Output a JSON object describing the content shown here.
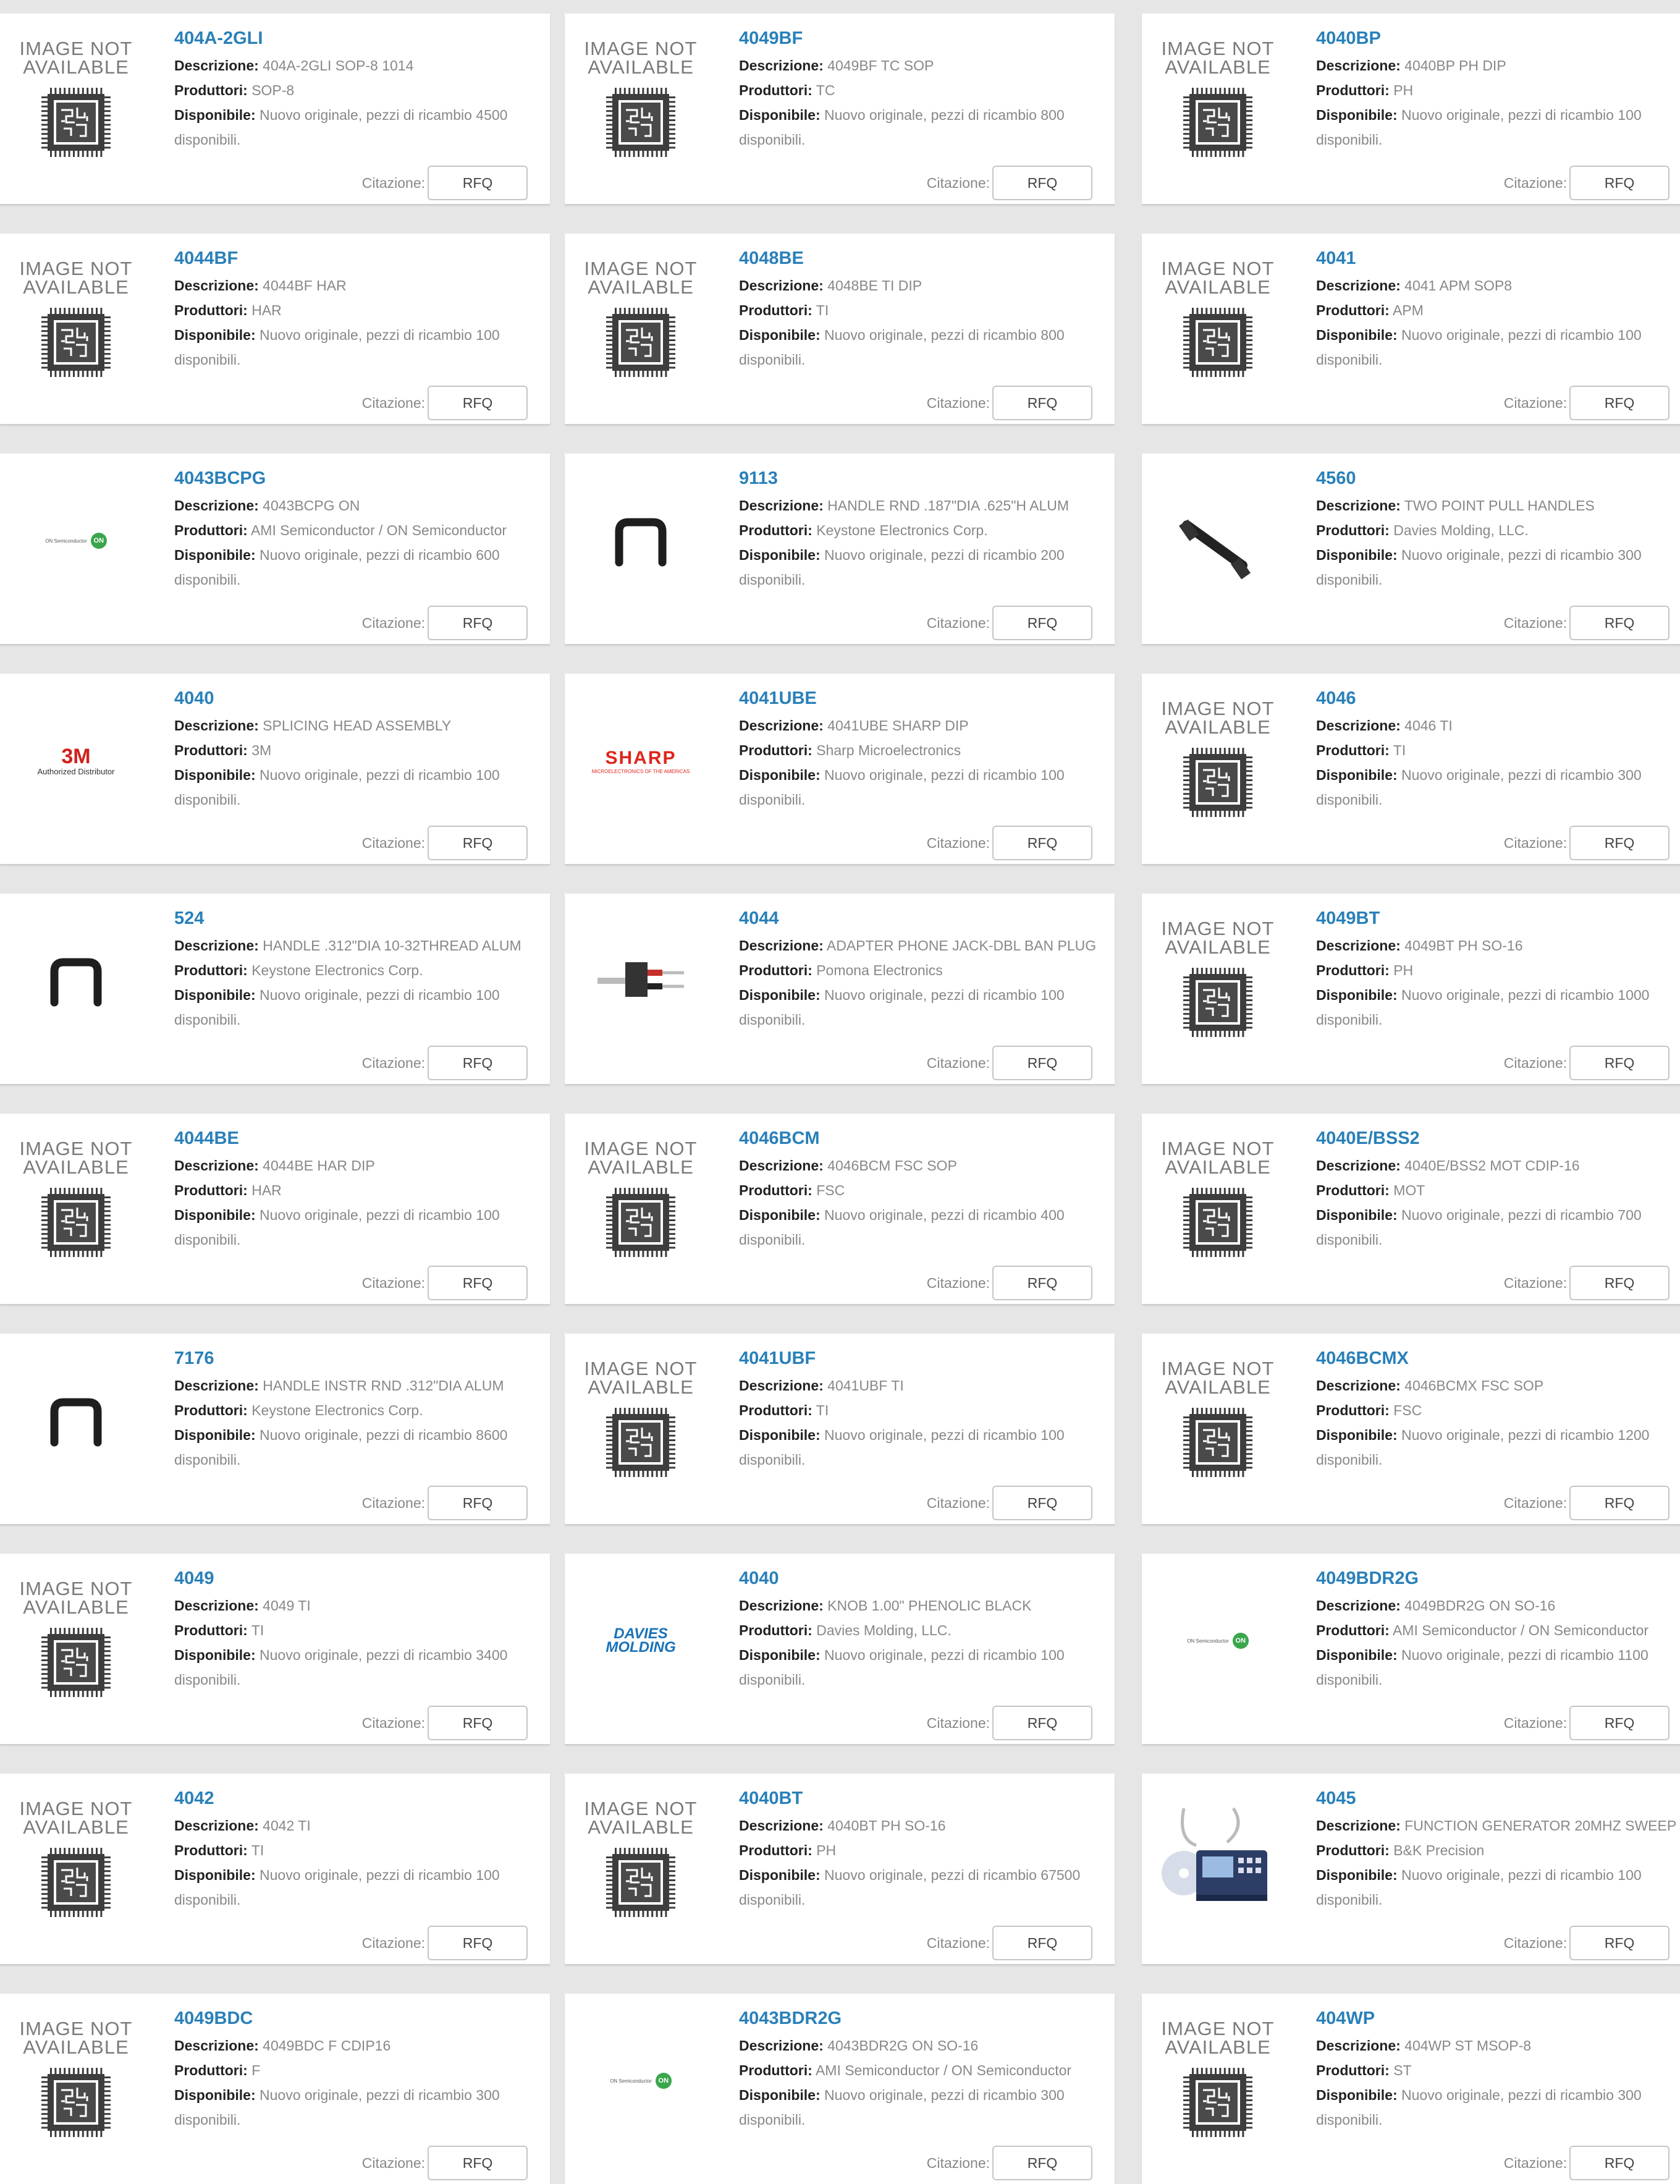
{
  "labels": {
    "description": "Descrizione:",
    "manufacturer": "Produttori:",
    "available": "Disponibile:",
    "quote": "Citazione:",
    "rfq": "RFQ",
    "image_not_available_1": "IMAGE NOT",
    "image_not_available_2": "AVAILABLE"
  },
  "products": [
    {
      "pn": "404A-2GLI",
      "desc": "404A-2GLI SOP-8 1014",
      "mfr": "SOP-8",
      "avail": "Nuovo originale, pezzi di ricambio 4500 disponibili.",
      "image": "image-not-available"
    },
    {
      "pn": "4049BF",
      "desc": "4049BF TC SOP",
      "mfr": "TC",
      "avail": "Nuovo originale, pezzi di ricambio 800 disponibili.",
      "image": "image-not-available"
    },
    {
      "pn": "4040BP",
      "desc": "4040BP PH DIP",
      "mfr": "PH",
      "avail": "Nuovo originale, pezzi di ricambio 100 disponibili.",
      "image": "image-not-available"
    },
    {
      "pn": "4044BF",
      "desc": "4044BF HAR",
      "mfr": "HAR",
      "avail": "Nuovo originale, pezzi di ricambio 100 disponibili.",
      "image": "image-not-available"
    },
    {
      "pn": "4048BE",
      "desc": "4048BE TI DIP",
      "mfr": "TI",
      "avail": "Nuovo originale, pezzi di ricambio 800 disponibili.",
      "image": "image-not-available"
    },
    {
      "pn": "4041",
      "desc": "4041 APM   SOP8",
      "mfr": "APM",
      "avail": "Nuovo originale, pezzi di ricambio 100 disponibili.",
      "image": "image-not-available"
    },
    {
      "pn": "4043BCPG",
      "desc": "4043BCPG ON",
      "mfr": "AMI Semiconductor / ON Semiconductor",
      "avail": "Nuovo originale, pezzi di ricambio 600 disponibili.",
      "image": "on-semi-logo"
    },
    {
      "pn": "9113",
      "desc": "HANDLE RND .187\"DIA .625\"H ALUM",
      "mfr": "Keystone Electronics Corp.",
      "avail": "Nuovo originale, pezzi di ricambio 200 disponibili.",
      "image": "handle-photo"
    },
    {
      "pn": "4560",
      "desc": "TWO POINT PULL HANDLES",
      "mfr": "Davies Molding, LLC.",
      "avail": "Nuovo originale, pezzi di ricambio 300 disponibili.",
      "image": "pull-handle-photo"
    },
    {
      "pn": "4040",
      "desc": "SPLICING HEAD ASSEMBLY",
      "mfr": "3M",
      "avail": "Nuovo originale, pezzi di ricambio 100 disponibili.",
      "image": "3m-logo"
    },
    {
      "pn": "4041UBE",
      "desc": "4041UBE SHARP DIP",
      "mfr": "Sharp Microelectronics",
      "avail": "Nuovo originale, pezzi di ricambio 100 disponibili.",
      "image": "sharp-logo"
    },
    {
      "pn": "4046",
      "desc": "4046 TI",
      "mfr": "TI",
      "avail": "Nuovo originale, pezzi di ricambio 300 disponibili.",
      "image": "image-not-available"
    },
    {
      "pn": "524",
      "desc": "HANDLE .312\"DIA 10-32THREAD ALUM",
      "mfr": "Keystone Electronics Corp.",
      "avail": "Nuovo originale, pezzi di ricambio 100 disponibili.",
      "image": "handle-photo"
    },
    {
      "pn": "4044",
      "desc": "ADAPTER PHONE JACK-DBL BAN PLUG",
      "mfr": "Pomona Electronics",
      "avail": "Nuovo originale, pezzi di ricambio 100 disponibili.",
      "image": "adapter-photo"
    },
    {
      "pn": "4049BT",
      "desc": "4049BT PH SO-16",
      "mfr": "PH",
      "avail": "Nuovo originale, pezzi di ricambio 1000 disponibili.",
      "image": "image-not-available"
    },
    {
      "pn": "4044BE",
      "desc": "4044BE HAR DIP",
      "mfr": "HAR",
      "avail": "Nuovo originale, pezzi di ricambio 100 disponibili.",
      "image": "image-not-available"
    },
    {
      "pn": "4046BCM",
      "desc": "4046BCM FSC SOP",
      "mfr": "FSC",
      "avail": "Nuovo originale, pezzi di ricambio 400 disponibili.",
      "image": "image-not-available"
    },
    {
      "pn": "4040E/BSS2",
      "desc": "4040E/BSS2 MOT CDIP-16",
      "mfr": "MOT",
      "avail": "Nuovo originale, pezzi di ricambio 700 disponibili.",
      "image": "image-not-available"
    },
    {
      "pn": "7176",
      "desc": "HANDLE INSTR RND .312\"DIA ALUM",
      "mfr": "Keystone Electronics Corp.",
      "avail": "Nuovo originale, pezzi di ricambio 8600 disponibili.",
      "image": "handle-photo"
    },
    {
      "pn": "4041UBF",
      "desc": "4041UBF TI",
      "mfr": "TI",
      "avail": "Nuovo originale, pezzi di ricambio 100 disponibili.",
      "image": "image-not-available"
    },
    {
      "pn": "4046BCMX",
      "desc": "4046BCMX FSC SOP",
      "mfr": "FSC",
      "avail": "Nuovo originale, pezzi di ricambio 1200 disponibili.",
      "image": "image-not-available"
    },
    {
      "pn": "4049",
      "desc": "4049 TI",
      "mfr": "TI",
      "avail": "Nuovo originale, pezzi di ricambio 3400 disponibili.",
      "image": "image-not-available"
    },
    {
      "pn": "4040",
      "desc": "KNOB 1.00\" PHENOLIC BLACK",
      "mfr": "Davies Molding, LLC.",
      "avail": "Nuovo originale, pezzi di ricambio 100 disponibili.",
      "image": "davies-logo"
    },
    {
      "pn": "4049BDR2G",
      "desc": "4049BDR2G ON SO-16",
      "mfr": "AMI Semiconductor / ON Semiconductor",
      "avail": "Nuovo originale, pezzi di ricambio 1100 disponibili.",
      "image": "on-semi-logo"
    },
    {
      "pn": "4042",
      "desc": "4042 TI",
      "mfr": "TI",
      "avail": "Nuovo originale, pezzi di ricambio 100 disponibili.",
      "image": "image-not-available"
    },
    {
      "pn": "4040BT",
      "desc": "4040BT PH SO-16",
      "mfr": "PH",
      "avail": "Nuovo originale, pezzi di ricambio 67500 disponibili.",
      "image": "image-not-available"
    },
    {
      "pn": "4045",
      "desc": "FUNCTION GENERATOR 20MHZ SWEEP",
      "mfr": "B&K Precision",
      "avail": "Nuovo originale, pezzi di ricambio 100 disponibili.",
      "image": "function-generator-photo"
    },
    {
      "pn": "4049BDC",
      "desc": "4049BDC F CDIP16",
      "mfr": "F",
      "avail": "Nuovo originale, pezzi di ricambio 300 disponibili.",
      "image": "image-not-available"
    },
    {
      "pn": "4043BDR2G",
      "desc": "4043BDR2G ON SO-16",
      "mfr": "AMI Semiconductor / ON Semiconductor",
      "avail": "Nuovo originale, pezzi di ricambio 300 disponibili.",
      "image": "on-semi-logo"
    },
    {
      "pn": "404WP",
      "desc": "404WP ST MSOP-8",
      "mfr": "ST",
      "avail": "Nuovo originale, pezzi di ricambio 300 disponibili.",
      "image": "image-not-available"
    }
  ],
  "logos": {
    "three_m_main": "3M",
    "three_m_sub": "Authorized Distributor",
    "sharp_main": "SHARP",
    "sharp_sub": "MICROELECTRONICS OF THE AMERICAS",
    "davies_1": "DAVIES",
    "davies_2": "MOLDING",
    "on_text": "ON Semiconductor",
    "on_mark": "ON"
  }
}
